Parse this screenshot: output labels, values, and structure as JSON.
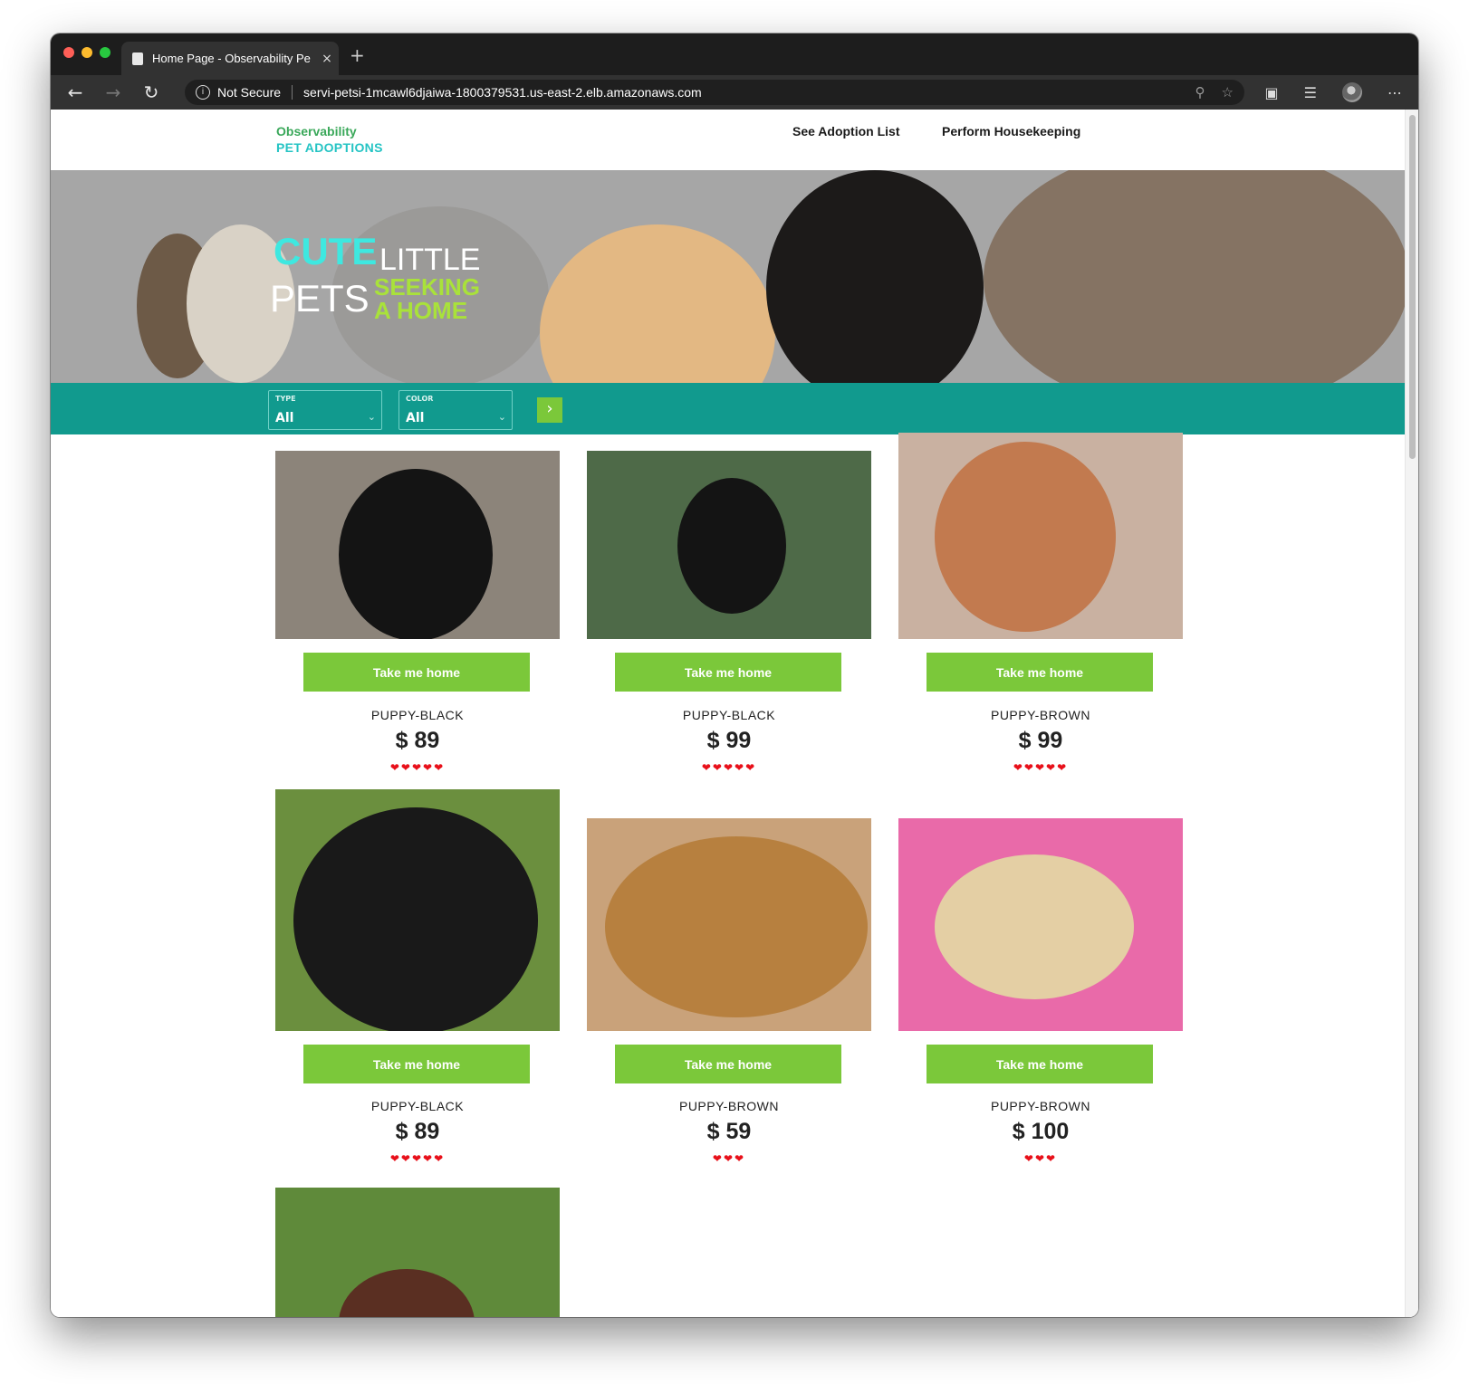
{
  "browser": {
    "tab_title": "Home Page - Observability Pe",
    "close_glyph": "×",
    "new_tab_glyph": "+",
    "not_secure": "Not Secure",
    "url": "servi-petsi-1mcawl6djaiwa-1800379531.us-east-2.elb.amazonaws.com",
    "traffic_colors": [
      "#ff5f57",
      "#febc2e",
      "#28c840"
    ]
  },
  "site": {
    "brand_line1": "Observability",
    "brand_line2": "PET ADOPTIONS",
    "nav": [
      "See Adoption List",
      "Perform Housekeeping"
    ]
  },
  "banner": {
    "word_cute": "CUTE",
    "word_little": "LITTLE",
    "word_pets": "PETS",
    "word_seeking": "SEEKING",
    "word_home": "A HOME"
  },
  "filters": {
    "type_label": "TYPE",
    "type_value": "All",
    "color_label": "COLOR",
    "color_value": "All"
  },
  "pets": [
    {
      "name": "PUPPY-BLACK",
      "price": "$ 89",
      "hearts": 5,
      "button": "Take me home"
    },
    {
      "name": "PUPPY-BLACK",
      "price": "$ 99",
      "hearts": 5,
      "button": "Take me home"
    },
    {
      "name": "PUPPY-BROWN",
      "price": "$ 99",
      "hearts": 5,
      "button": "Take me home"
    },
    {
      "name": "PUPPY-BLACK",
      "price": "$ 89",
      "hearts": 5,
      "button": "Take me home"
    },
    {
      "name": "PUPPY-BROWN",
      "price": "$ 59",
      "hearts": 3,
      "button": "Take me home"
    },
    {
      "name": "PUPPY-BROWN",
      "price": "$ 100",
      "hearts": 3,
      "button": "Take me home"
    }
  ],
  "colors": {
    "accent_green": "#7bc83a",
    "teal": "#119a8e",
    "heart_red": "#e8101a",
    "brand_green": "#3aa85a",
    "brand_teal": "#25c4c4"
  }
}
